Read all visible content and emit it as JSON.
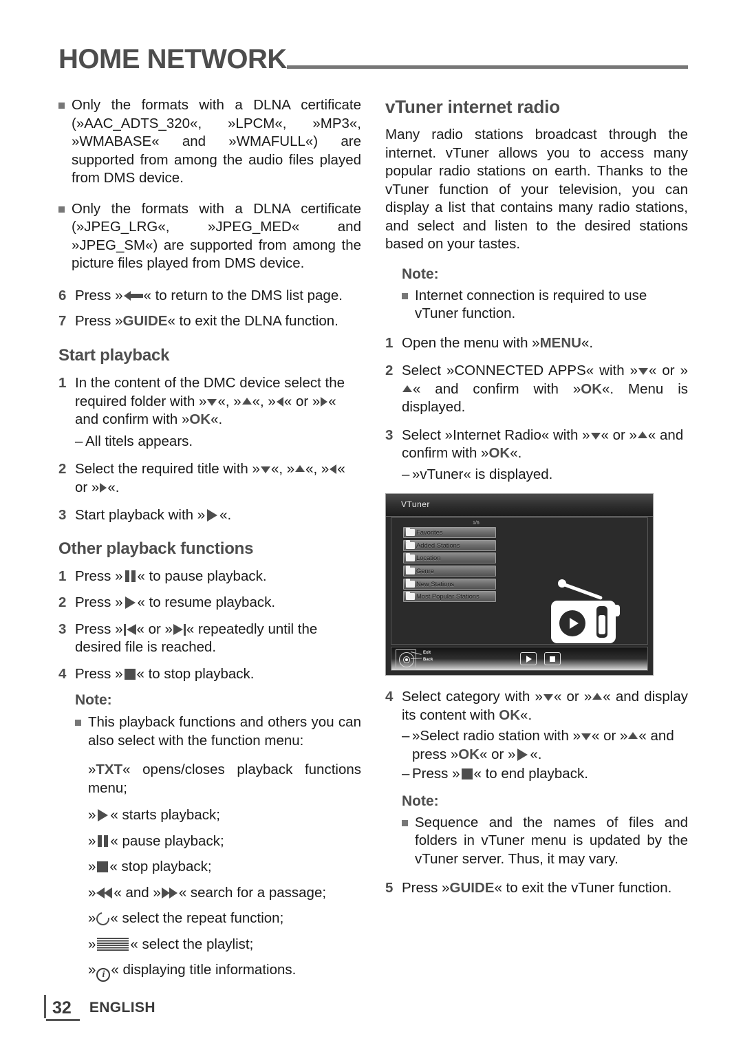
{
  "header": {
    "title": "HOME NETWORK"
  },
  "left_column": {
    "bullets": [
      "Only the formats with a DLNA certificate (»AAC_ADTS_320«, »LPCM«, »MP3«, »WMABASE« and »WMAFULL«) are supported from among the audio files played from DMS device.",
      "Only the formats with a DLNA certificate (»JPEG_LRG«, »JPEG_MED« and »JPEG_SM«) are supported from among the picture files played from DMS device."
    ],
    "step6": {
      "num": "6",
      "pre": "Press »",
      "post": "« to return to the DMS list page."
    },
    "step7": {
      "num": "7",
      "pre": "Press »",
      "key": "GUIDE",
      "post": "« to exit the DLNA function."
    },
    "start_playback": {
      "title": "Start playback",
      "step1": {
        "num": "1",
        "t1": "In the content of the DMC device select the required folder with »",
        "t2": "«, »",
        "t3": "«, »",
        "t4": "« or »",
        "t5": "« and confirm with »",
        "key_ok": "OK",
        "t6": "«.",
        "sub": "All titels appears."
      },
      "step2": {
        "num": "2",
        "t1": "Select the required title with »",
        "t2": "«, »",
        "t3": "«, »",
        "t4": "« or »",
        "t5": "«."
      },
      "step3": {
        "num": "3",
        "t1": "Start playback with »",
        "t2": "«."
      }
    },
    "other_playback": {
      "title": "Other playback functions",
      "step1": {
        "num": "1",
        "t1": "Press »",
        "t2": "« to pause playback."
      },
      "step2": {
        "num": "2",
        "t1": "Press »",
        "t2": "« to resume playback."
      },
      "step3": {
        "num": "3",
        "t1": "Press »",
        "t2": "« or »",
        "t3": "« repeatedly until the desired file is reached."
      },
      "step4": {
        "num": "4",
        "t1": "Press »",
        "t2": "« to stop playback."
      },
      "note": {
        "title": "Note:",
        "bullet": "This playback functions and others you can also select with the function menu:",
        "txt_line": {
          "pre": "»",
          "key": "TXT",
          "post": "« opens/closes playback functions menu;"
        },
        "items": [
          {
            "icon": "play-icon",
            "text": "« starts playback;"
          },
          {
            "icon": "pause-icon",
            "text": "« pause playback;"
          },
          {
            "icon": "stop-icon",
            "text": "« stop playback;"
          },
          {
            "icon": "rewind-forward-icon",
            "text": "« search for a passage;"
          },
          {
            "icon": "repeat-icon",
            "text": "« select the repeat function;"
          },
          {
            "icon": "playlist-icon",
            "text": "« select the playlist;"
          },
          {
            "icon": "info-icon",
            "text": "« displaying title informations."
          }
        ],
        "search_mid": "« and »"
      }
    }
  },
  "right_column": {
    "title": "vTuner internet radio",
    "intro": "Many radio stations broadcast through the internet. vTuner allows you to access many popular radio stations on earth. Thanks to the vTuner function of your television, you can display a list that contains many radio stations, and select and listen to the desired stations based on your tastes.",
    "note1": {
      "title": "Note:",
      "bullet": "Internet connection is required to use vTuner function."
    },
    "step1": {
      "num": "1",
      "t1": "Open the menu with »",
      "key": "MENU",
      "t2": "«."
    },
    "step2": {
      "num": "2",
      "t1": "Select »CONNECTED APPS« with »",
      "t2": "« or »",
      "t3": "« and confirm with »",
      "key_ok": "OK",
      "t4": "«. Menu is displayed."
    },
    "step3": {
      "num": "3",
      "t1": "Select »Internet Radio« with »",
      "t2": "« or »",
      "t3": "« and confirm with »",
      "key_ok": "OK",
      "t4": "«.",
      "sub": "»vTuner« is displayed."
    },
    "step4": {
      "num": "4",
      "t1": "Select category with »",
      "t2": "« or »",
      "t3": "« and display its content with ",
      "key_ok": "OK",
      "t4": "«.",
      "sub1_a": "»Select radio station with »",
      "sub1_b": "« or »",
      "sub1_c": "« and press »",
      "sub1_key": "OK",
      "sub1_d": "« or »",
      "sub1_e": "«.",
      "sub2_a": "Press »",
      "sub2_b": "« to end playback."
    },
    "note2": {
      "title": "Note:",
      "bullet": "Sequence and the names of files and folders in vTuner menu is updated by the vTuner server. Thus, it may vary."
    },
    "step5": {
      "num": "5",
      "t1": "Press »",
      "key": "GUIDE",
      "t2": "« to exit the vTuner function."
    }
  },
  "tv_screenshot": {
    "title": "VTuner",
    "page_indicator": "1/6",
    "menu_items": [
      "Favorites",
      "Added Stations",
      "Location",
      "Genre",
      "New Stations",
      "Most Popular Stations"
    ],
    "bottom_bar": {
      "exit_label": "Exit",
      "back_label": "Back"
    }
  },
  "footer": {
    "page": "32",
    "language": "ENGLISH"
  }
}
